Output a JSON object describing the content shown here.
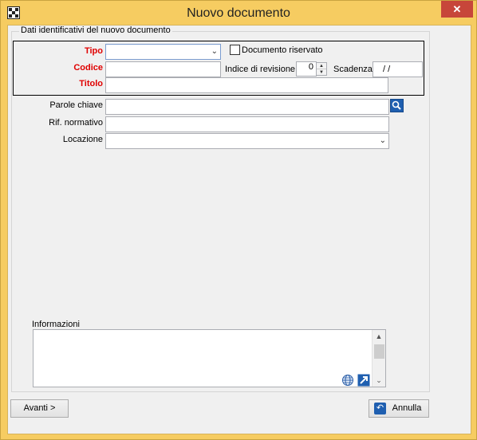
{
  "window": {
    "title": "Nuovo documento",
    "close_glyph": "✕",
    "app_icon": "app-grid-icon"
  },
  "group": {
    "title": "Dati identificativi del nuovo documento"
  },
  "fields": {
    "tipo": {
      "label": "Tipo",
      "value": ""
    },
    "riservato": {
      "label": "Documento riservato",
      "checked": false
    },
    "codice": {
      "label": "Codice",
      "value": ""
    },
    "indice": {
      "label": "Indice di revisione",
      "value": "0"
    },
    "scadenza": {
      "label": "Scadenza",
      "value": " /   /"
    },
    "titolo": {
      "label": "Titolo",
      "value": ""
    },
    "parole_chiave": {
      "label": "Parole chiave",
      "value": ""
    },
    "rif_normativo": {
      "label": "Rif. normativo",
      "value": ""
    },
    "locazione": {
      "label": "Locazione",
      "value": ""
    }
  },
  "informazioni": {
    "label": "Informazioni",
    "value": ""
  },
  "buttons": {
    "avanti": "Avanti >",
    "annulla": "Annulla"
  },
  "colors": {
    "frame": "#f6cc61",
    "required_label": "#e00000",
    "accent": "#1f5fb0"
  }
}
